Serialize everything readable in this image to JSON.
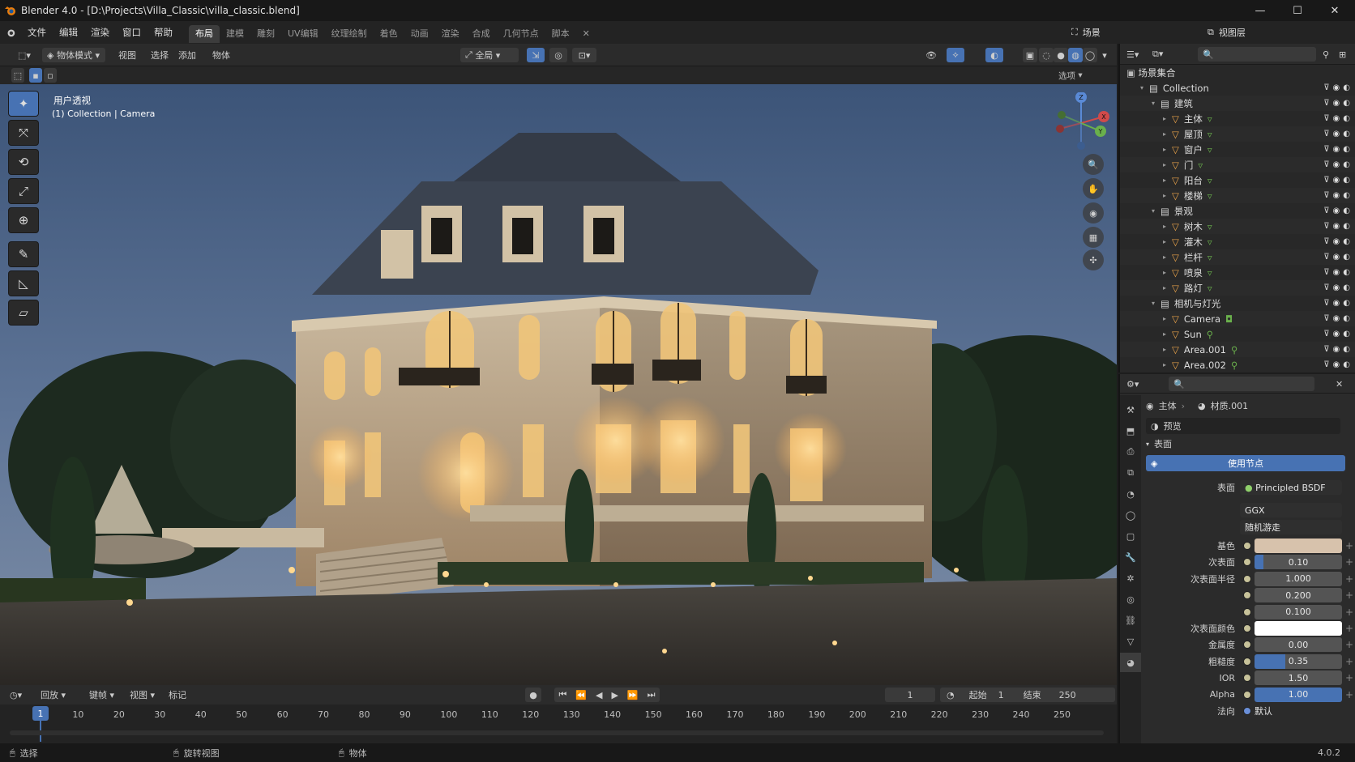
{
  "window": {
    "title": "Blender 4.0 - [D:\\Projects\\Villa_Classic\\villa_classic.blend]",
    "minimize": "—",
    "maximize": "☐",
    "close": "✕"
  },
  "menu": [
    "文件",
    "编辑",
    "渲染",
    "窗口",
    "帮助"
  ],
  "workspaces": {
    "tabs": [
      "布局",
      "建模",
      "雕刻",
      "UV编辑",
      "纹理绘制",
      "着色",
      "动画",
      "渲染",
      "合成",
      "几何节点",
      "脚本"
    ],
    "active": 0,
    "close": "✕"
  },
  "top_right": {
    "scene": "场景",
    "view_layer": "视图层"
  },
  "viewport_header": {
    "mode": "物体模式",
    "view": "视图",
    "select": "选择",
    "add": "添加",
    "object": "物体",
    "transform": "全局",
    "options": "选项"
  },
  "viewport": {
    "label1": "用户透视",
    "label2": "(1) Collection | Camera"
  },
  "toolbar": [
    {
      "name": "cursor-tool",
      "icon": "✦"
    },
    {
      "name": "move-tool",
      "icon": "⤧"
    },
    {
      "name": "rotate-tool",
      "icon": "⟲"
    },
    {
      "name": "scale-tool",
      "icon": "⤢"
    },
    {
      "name": "transform-tool",
      "icon": "⊕"
    },
    {
      "name": "annotate-tool",
      "icon": "✎"
    },
    {
      "name": "measure-tool",
      "icon": "◺"
    },
    {
      "name": "add-cube-tool",
      "icon": "▱"
    }
  ],
  "gizmo": {
    "x": "X",
    "y": "Y",
    "z": "Z"
  },
  "timeline": {
    "menus": [
      "回放",
      "键帧",
      "视图",
      "标记"
    ],
    "current_frame": "1",
    "start_label": "起始",
    "start": "1",
    "end_label": "结束",
    "end": "250",
    "ticks": [
      "1",
      "10",
      "20",
      "30",
      "40",
      "50",
      "60",
      "70",
      "80",
      "90",
      "100",
      "110",
      "120",
      "130",
      "140",
      "150",
      "160",
      "170",
      "180",
      "190",
      "200",
      "210",
      "220",
      "230",
      "240",
      "250"
    ]
  },
  "status": {
    "left": "选择",
    "mid": "旋转视图",
    "right": "物体",
    "version": "4.0.2"
  },
  "outliner": {
    "root": "场景集合",
    "rows": [
      {
        "label": "Collection",
        "indent": 1,
        "type": "collection"
      },
      {
        "label": "建筑",
        "indent": 2,
        "type": "collection"
      },
      {
        "label": "主体",
        "indent": 3,
        "type": "mesh"
      },
      {
        "label": "屋顶",
        "indent": 3,
        "type": "mesh"
      },
      {
        "label": "窗户",
        "indent": 3,
        "type": "mesh"
      },
      {
        "label": "门",
        "indent": 3,
        "type": "mesh"
      },
      {
        "label": "阳台",
        "indent": 3,
        "type": "mesh"
      },
      {
        "label": "楼梯",
        "indent": 3,
        "type": "mesh"
      },
      {
        "label": "景观",
        "indent": 2,
        "type": "collection"
      },
      {
        "label": "树木",
        "indent": 3,
        "type": "mesh"
      },
      {
        "label": "灌木",
        "indent": 3,
        "type": "mesh"
      },
      {
        "label": "栏杆",
        "indent": 3,
        "type": "mesh"
      },
      {
        "label": "喷泉",
        "indent": 3,
        "type": "mesh"
      },
      {
        "label": "路灯",
        "indent": 3,
        "type": "mesh"
      },
      {
        "label": "相机与灯光",
        "indent": 2,
        "type": "collection"
      },
      {
        "label": "Camera",
        "indent": 3,
        "type": "camera"
      },
      {
        "label": "Sun",
        "indent": 3,
        "type": "light"
      },
      {
        "label": "Area.001",
        "indent": 3,
        "type": "light"
      },
      {
        "label": "Area.002",
        "indent": 3,
        "type": "light"
      }
    ]
  },
  "properties": {
    "object": "主体",
    "material": "材质.001",
    "preview": "预览",
    "section": "表面",
    "use_nodes": "使用节点",
    "surface_label": "表面",
    "surface": "Principled BSDF",
    "distribution": "GGX",
    "subsurface_method": "随机游走",
    "rows": [
      {
        "label": "基色",
        "value": "",
        "kind": "color",
        "color": "#d7c2ac"
      },
      {
        "label": "次表面",
        "value": "0.10",
        "kind": "slider",
        "fill": 0.1
      },
      {
        "label": "次表面半径",
        "value": "1.000",
        "kind": "num"
      },
      {
        "label": "",
        "value": "0.200",
        "kind": "num"
      },
      {
        "label": "",
        "value": "0.100",
        "kind": "num"
      },
      {
        "label": "次表面颜色",
        "value": "",
        "kind": "color",
        "color": "#ffffff"
      },
      {
        "label": "金属度",
        "value": "0.00",
        "kind": "slider",
        "fill": 0
      },
      {
        "label": "粗糙度",
        "value": "0.35",
        "kind": "slider",
        "fill": 0.35
      },
      {
        "label": "IOR",
        "value": "1.50",
        "kind": "num"
      },
      {
        "label": "Alpha",
        "value": "1.00",
        "kind": "slider",
        "fill": 1.0
      },
      {
        "label": "法向",
        "value": "默认",
        "kind": "link"
      }
    ]
  },
  "colors": {
    "accent": "#4772b3",
    "mesh_icon": "#e8a24a",
    "visible": "#dddddd"
  }
}
